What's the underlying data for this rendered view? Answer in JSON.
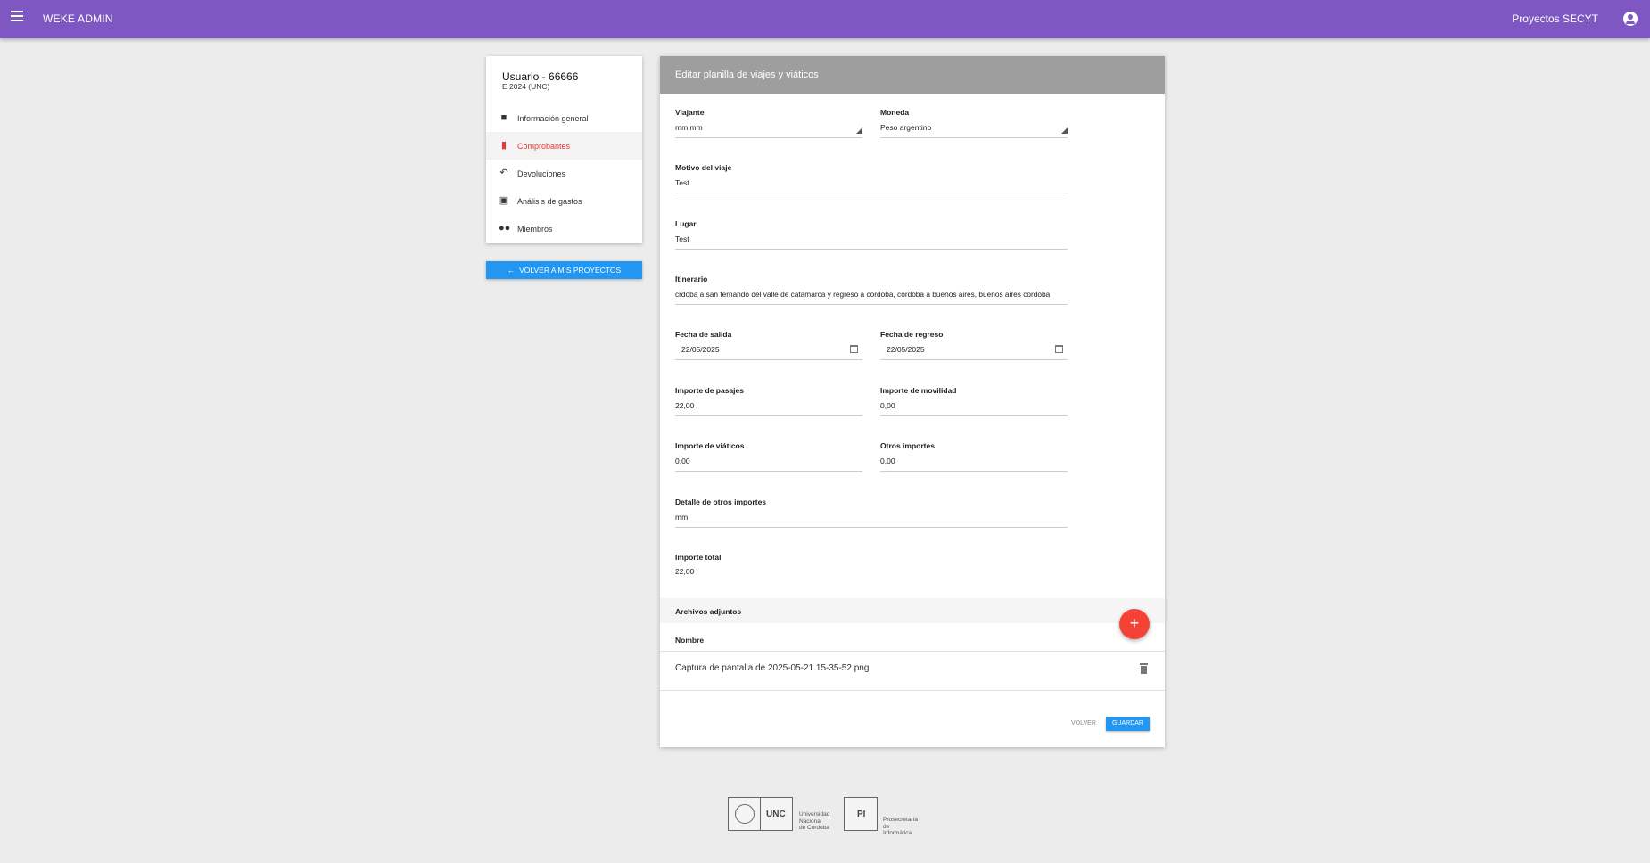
{
  "app": {
    "title": "WEKE ADMIN",
    "right_label": "Proyectos SECYT",
    "menu_icon": "menu-icon",
    "account_icon": "account-circle-icon"
  },
  "sidebar": {
    "user": "Usuario - 66666",
    "subtitle": "E 2024 (UNC)",
    "items": [
      {
        "label": "Información general",
        "icon": "book-icon",
        "active": false
      },
      {
        "label": "Comprobantes",
        "icon": "document-icon",
        "active": true
      },
      {
        "label": "Devoluciones",
        "icon": "reply-icon",
        "active": false
      },
      {
        "label": "Análisis de gastos",
        "icon": "find-in-page-icon",
        "active": false
      },
      {
        "label": "Miembros",
        "icon": "people-icon",
        "active": false
      }
    ],
    "back_button": "VOLVER A MIS PROYECTOS"
  },
  "form": {
    "title": "Editar planilla de viajes y viáticos",
    "viajante": {
      "label": "Viajante",
      "value": "mm mm"
    },
    "moneda": {
      "label": "Moneda",
      "value": "Peso argentino"
    },
    "motivo": {
      "label": "Motivo del viaje",
      "value": "Test"
    },
    "lugar": {
      "label": "Lugar",
      "value": "Test"
    },
    "itinerario": {
      "label": "Itinerario",
      "value": "crdoba a san fernando del valle de catamarca y regreso a cordoba,  cordoba a buenos aires, buenos aires cordoba"
    },
    "fecha_salida": {
      "label": "Fecha de salida",
      "value": "22/05/2025"
    },
    "fecha_regreso": {
      "label": "Fecha de regreso",
      "value": "22/05/2025"
    },
    "importe_pasajes": {
      "label": "Importe de pasajes",
      "value": "22,00"
    },
    "importe_movilidad": {
      "label": "Importe de movilidad",
      "value": "0,00"
    },
    "importe_viaticos": {
      "label": "Importe de viáticos",
      "value": "0,00"
    },
    "otros_importes": {
      "label": "Otros importes",
      "value": "0,00"
    },
    "detalle_otros": {
      "label": "Detalle de otros importes",
      "value": "mm"
    },
    "importe_total": {
      "label": "Importe total",
      "value": "22,00"
    }
  },
  "attachments": {
    "title": "Archivos adjuntos",
    "column": "Nombre",
    "add_icon": "+",
    "files": [
      {
        "name": "Captura de pantalla de 2025-05-21 15-35-52.png"
      }
    ]
  },
  "actions": {
    "volver": "VOLVER",
    "guardar": "GUARDAR"
  },
  "footer": {
    "unc": "UNC",
    "unc_text": [
      "Universidad",
      "Nacional",
      "de Córdoba"
    ],
    "pi": "PI",
    "pi_text": [
      "Prosecretaría",
      "de Informática"
    ]
  },
  "colors": {
    "topbar": "#7e57c2",
    "primary_button": "#2196f3",
    "fab": "#f44336",
    "active_item": "#e53935",
    "card_header": "#9e9e9e"
  }
}
